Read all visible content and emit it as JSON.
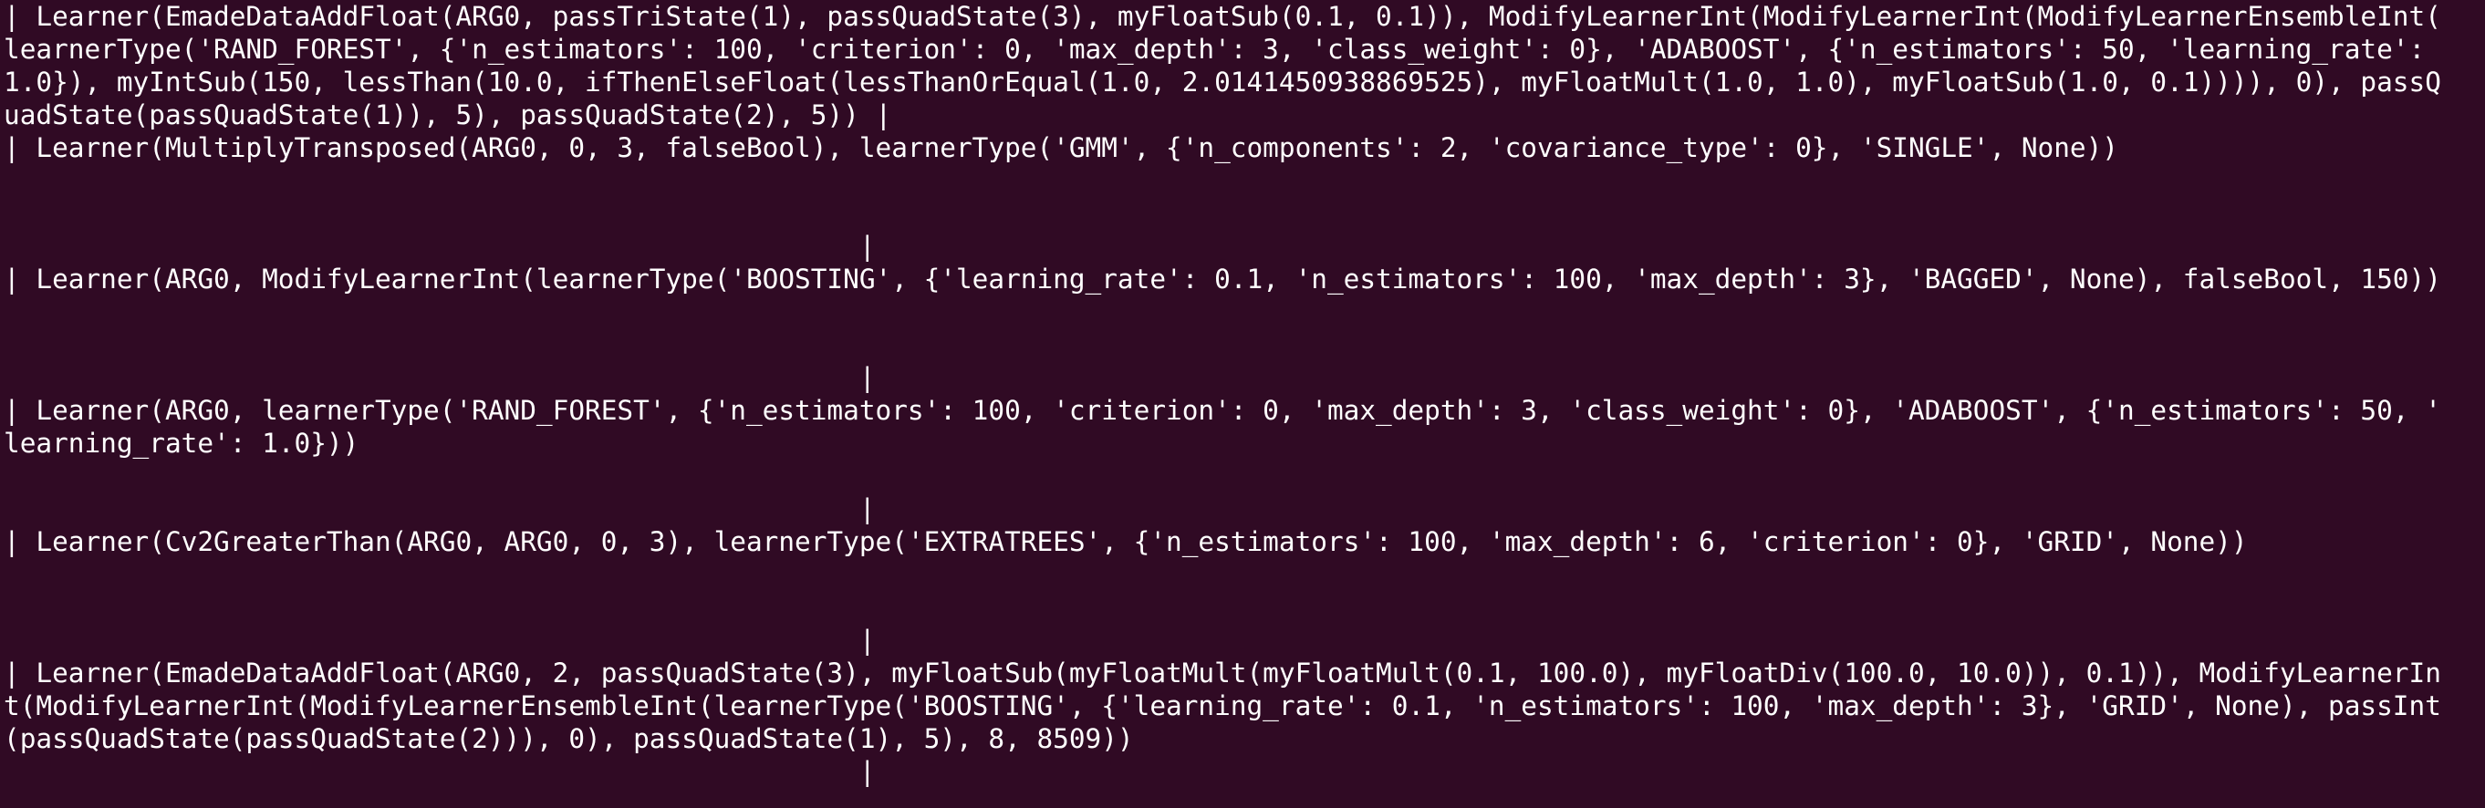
{
  "terminal": {
    "lines": [
      "| Learner(EmadeDataAddFloat(ARG0, passTriState(1), passQuadState(3), myFloatSub(0.1, 0.1)), ModifyLearnerInt(ModifyLearnerInt(ModifyLearnerEnsembleInt(",
      "learnerType('RAND_FOREST', {'n_estimators': 100, 'criterion': 0, 'max_depth': 3, 'class_weight': 0}, 'ADABOOST', {'n_estimators': 50, 'learning_rate':",
      "1.0}), myIntSub(150, lessThan(10.0, ifThenElseFloat(lessThanOrEqual(1.0, 2.0141450938869525), myFloatMult(1.0, 1.0), myFloatSub(1.0, 0.1)))), 0), passQ",
      "uadState(passQuadState(1)), 5), passQuadState(2), 5)) |",
      "| Learner(MultiplyTransposed(ARG0, 0, 3, falseBool), learnerType('GMM', {'n_components': 2, 'covariance_type': 0}, 'SINGLE', None))",
      "",
      "",
      "                                                     |",
      "| Learner(ARG0, ModifyLearnerInt(learnerType('BOOSTING', {'learning_rate': 0.1, 'n_estimators': 100, 'max_depth': 3}, 'BAGGED', None), falseBool, 150))",
      "",
      "",
      "                                                     |",
      "| Learner(ARG0, learnerType('RAND_FOREST', {'n_estimators': 100, 'criterion': 0, 'max_depth': 3, 'class_weight': 0}, 'ADABOOST', {'n_estimators': 50, '",
      "learning_rate': 1.0}))",
      "",
      "                                                     |",
      "| Learner(Cv2GreaterThan(ARG0, ARG0, 0, 3), learnerType('EXTRATREES', {'n_estimators': 100, 'max_depth': 6, 'criterion': 0}, 'GRID', None))",
      "",
      "",
      "                                                     |",
      "| Learner(EmadeDataAddFloat(ARG0, 2, passQuadState(3), myFloatSub(myFloatMult(myFloatMult(0.1, 100.0), myFloatDiv(100.0, 10.0)), 0.1)), ModifyLearnerIn",
      "t(ModifyLearnerInt(ModifyLearnerEnsembleInt(learnerType('BOOSTING', {'learning_rate': 0.1, 'n_estimators': 100, 'max_depth': 3}, 'GRID', None), passInt",
      "(passQuadState(passQuadState(2))), 0), passQuadState(1), 5), 8, 8509))",
      "                                                     |"
    ]
  }
}
